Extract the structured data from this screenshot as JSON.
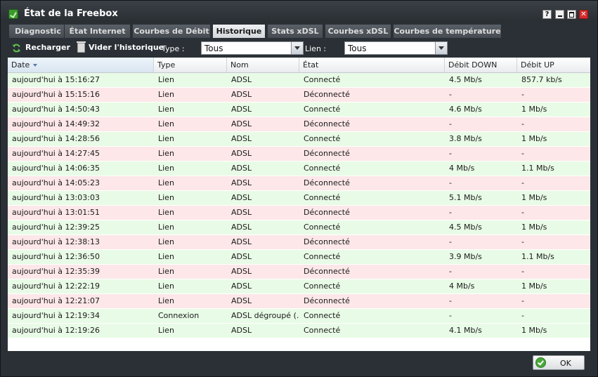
{
  "window": {
    "title": "État de la Freebox"
  },
  "title_buttons": {
    "help": "?",
    "close": "✕"
  },
  "tabs": [
    {
      "label": "Diagnostic"
    },
    {
      "label": "État Internet"
    },
    {
      "label": "Courbes de Débit"
    },
    {
      "label": "Historique"
    },
    {
      "label": "Stats xDSL"
    },
    {
      "label": "Courbes xDSL"
    },
    {
      "label": "Courbes de température"
    }
  ],
  "active_tab": "Historique",
  "toolbar": {
    "reload_label": "Recharger",
    "clear_label": "Vider l'historique",
    "type_label": "Type :",
    "type_value": "Tous",
    "link_label": "Lien :",
    "link_value": "Tous"
  },
  "columns": [
    "Date",
    "Type",
    "Nom",
    "État",
    "Débit DOWN",
    "Débit UP"
  ],
  "sorted_column": "Date",
  "rows": [
    {
      "date": "aujourd'hui à 15:16:27",
      "type": "Lien",
      "nom": "ADSL",
      "etat": "Connecté",
      "down": "4.5 Mb/s",
      "up": "857.7 kb/s",
      "status": "ok"
    },
    {
      "date": "aujourd'hui à 15:15:16",
      "type": "Lien",
      "nom": "ADSL",
      "etat": "Déconnecté",
      "down": "-",
      "up": "-",
      "status": "ko"
    },
    {
      "date": "aujourd'hui à 14:50:43",
      "type": "Lien",
      "nom": "ADSL",
      "etat": "Connecté",
      "down": "4.6 Mb/s",
      "up": "1 Mb/s",
      "status": "ok"
    },
    {
      "date": "aujourd'hui à 14:49:32",
      "type": "Lien",
      "nom": "ADSL",
      "etat": "Déconnecté",
      "down": "-",
      "up": "-",
      "status": "ko"
    },
    {
      "date": "aujourd'hui à 14:28:56",
      "type": "Lien",
      "nom": "ADSL",
      "etat": "Connecté",
      "down": "3.8 Mb/s",
      "up": "1 Mb/s",
      "status": "ok"
    },
    {
      "date": "aujourd'hui à 14:27:45",
      "type": "Lien",
      "nom": "ADSL",
      "etat": "Déconnecté",
      "down": "-",
      "up": "-",
      "status": "ko"
    },
    {
      "date": "aujourd'hui à 14:06:35",
      "type": "Lien",
      "nom": "ADSL",
      "etat": "Connecté",
      "down": "4 Mb/s",
      "up": "1.1 Mb/s",
      "status": "ok"
    },
    {
      "date": "aujourd'hui à 14:05:23",
      "type": "Lien",
      "nom": "ADSL",
      "etat": "Déconnecté",
      "down": "-",
      "up": "-",
      "status": "ko"
    },
    {
      "date": "aujourd'hui à 13:03:03",
      "type": "Lien",
      "nom": "ADSL",
      "etat": "Connecté",
      "down": "5.1 Mb/s",
      "up": "1 Mb/s",
      "status": "ok"
    },
    {
      "date": "aujourd'hui à 13:01:51",
      "type": "Lien",
      "nom": "ADSL",
      "etat": "Déconnecté",
      "down": "-",
      "up": "-",
      "status": "ko"
    },
    {
      "date": "aujourd'hui à 12:39:25",
      "type": "Lien",
      "nom": "ADSL",
      "etat": "Connecté",
      "down": "4.5 Mb/s",
      "up": "1 Mb/s",
      "status": "ok"
    },
    {
      "date": "aujourd'hui à 12:38:13",
      "type": "Lien",
      "nom": "ADSL",
      "etat": "Déconnecté",
      "down": "-",
      "up": "-",
      "status": "ko"
    },
    {
      "date": "aujourd'hui à 12:36:50",
      "type": "Lien",
      "nom": "ADSL",
      "etat": "Connecté",
      "down": "3.9 Mb/s",
      "up": "1.1 Mb/s",
      "status": "ok"
    },
    {
      "date": "aujourd'hui à 12:35:39",
      "type": "Lien",
      "nom": "ADSL",
      "etat": "Déconnecté",
      "down": "-",
      "up": "-",
      "status": "ko"
    },
    {
      "date": "aujourd'hui à 12:22:19",
      "type": "Lien",
      "nom": "ADSL",
      "etat": "Connecté",
      "down": "4 Mb/s",
      "up": "1 Mb/s",
      "status": "ok"
    },
    {
      "date": "aujourd'hui à 12:21:07",
      "type": "Lien",
      "nom": "ADSL",
      "etat": "Déconnecté",
      "down": "-",
      "up": "-",
      "status": "ko"
    },
    {
      "date": "aujourd'hui à 12:19:34",
      "type": "Connexion",
      "nom": "ADSL dégroupé (...",
      "etat": "Connecté",
      "down": "-",
      "up": "-",
      "status": "ok"
    },
    {
      "date": "aujourd'hui à 12:19:26",
      "type": "Lien",
      "nom": "ADSL",
      "etat": "Connecté",
      "down": "4.1 Mb/s",
      "up": "1 Mb/s",
      "status": "ok"
    }
  ],
  "footer": {
    "ok_label": "OK"
  },
  "colors": {
    "row_connected": "#e8fbe6",
    "row_disconnected": "#fde7e8",
    "window_bg": "#2b3036",
    "active_tab": "#e0e4e8"
  }
}
